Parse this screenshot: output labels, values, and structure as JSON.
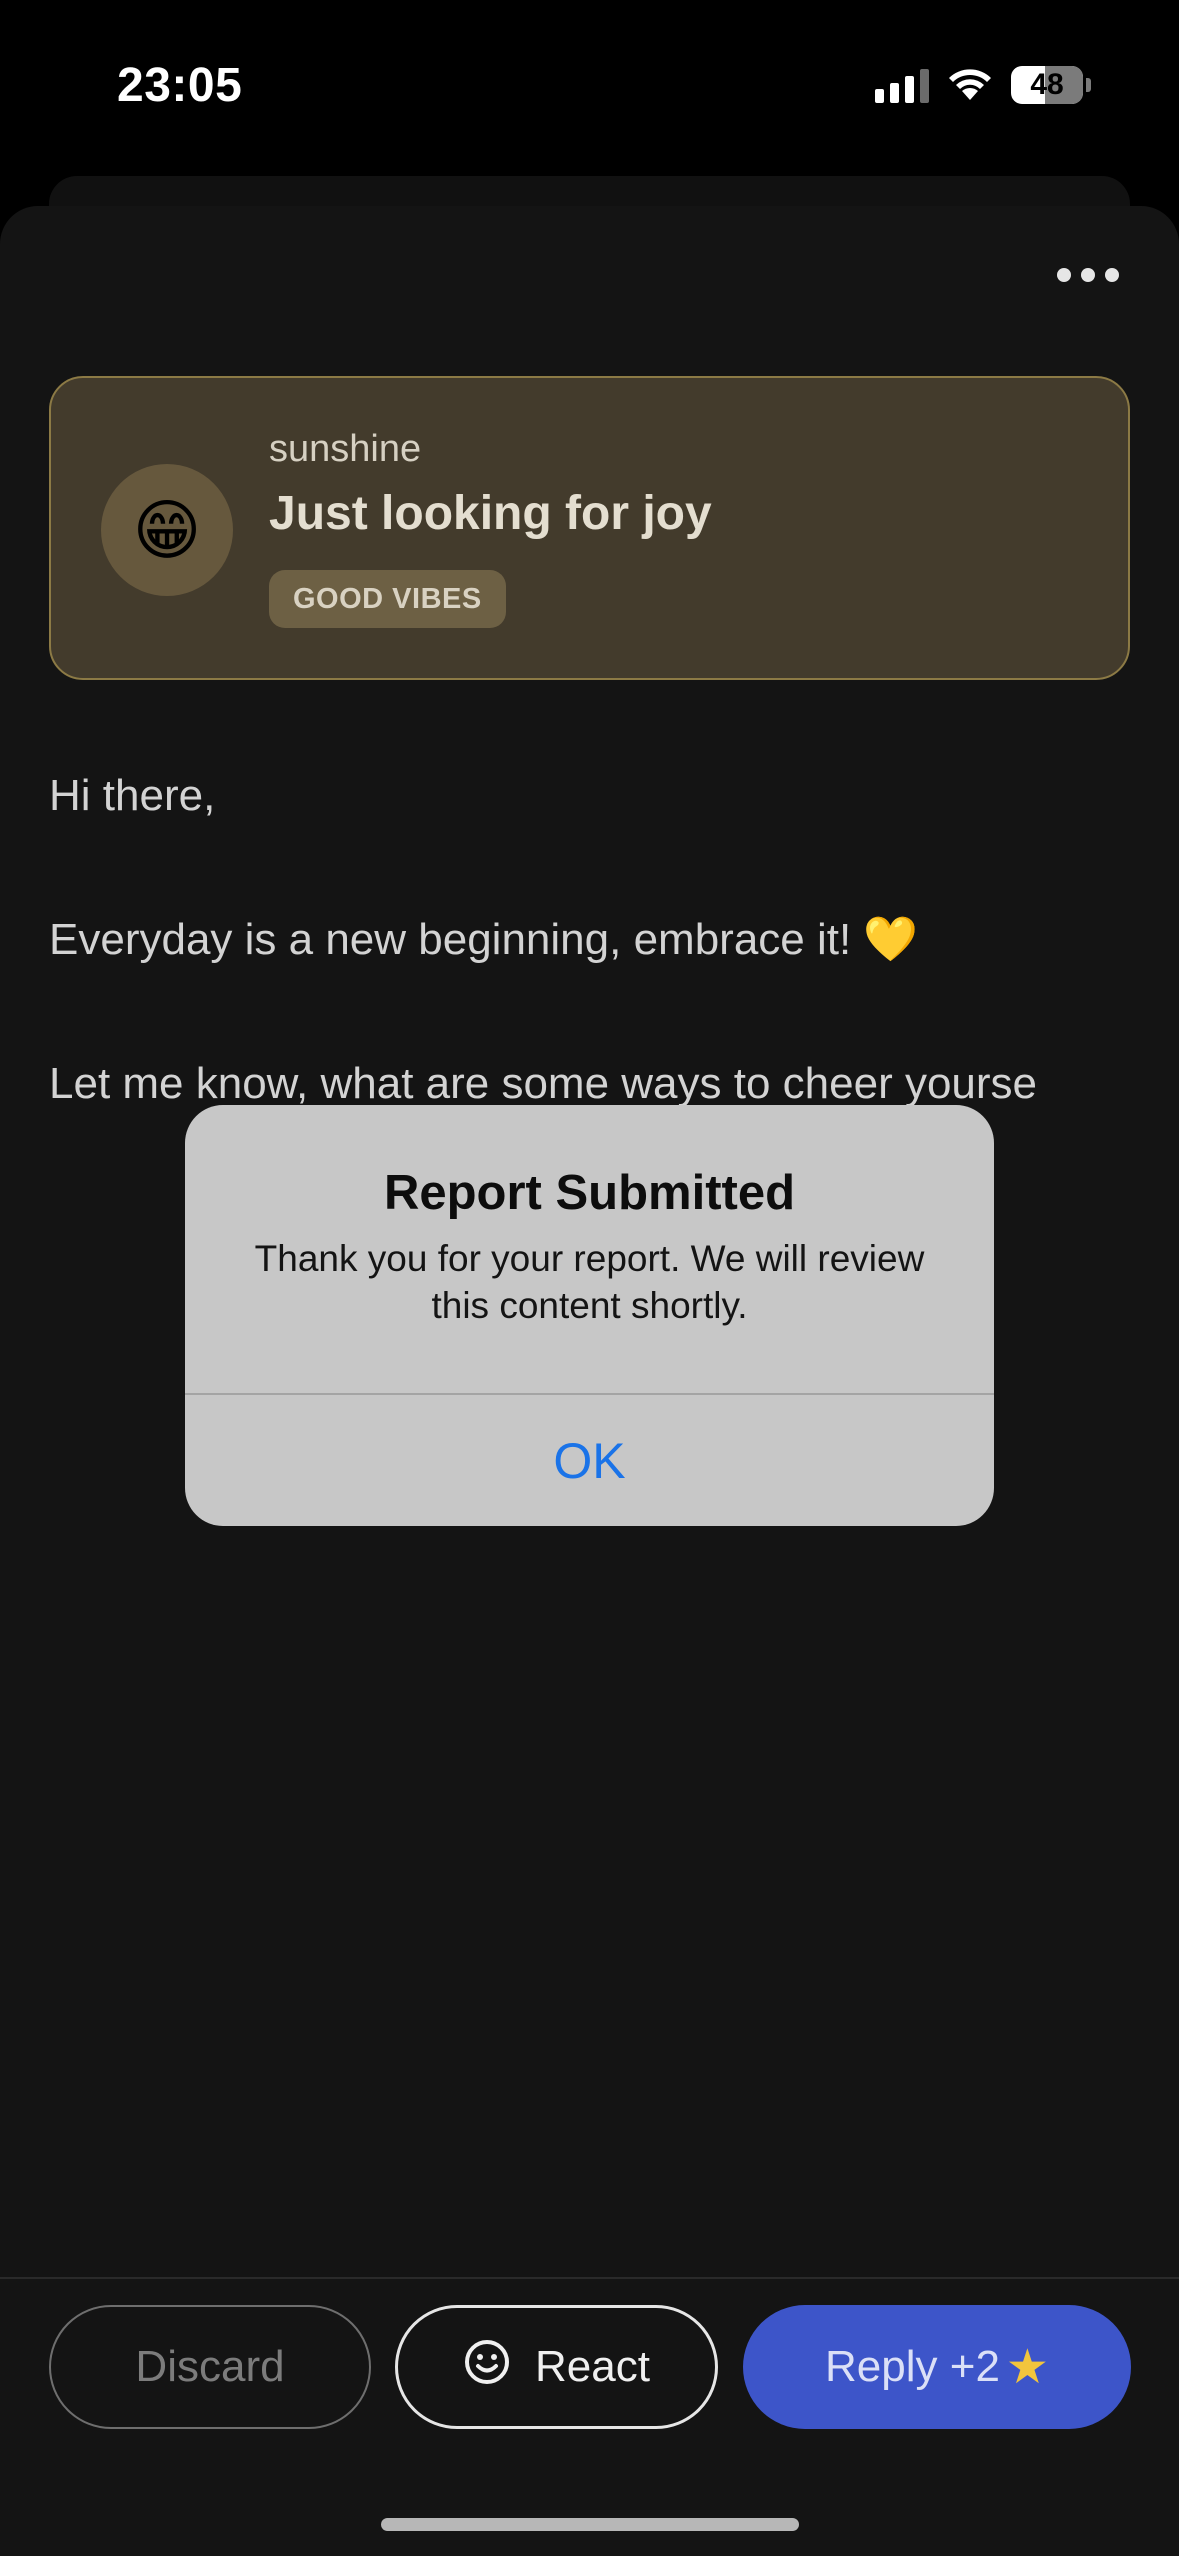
{
  "status_bar": {
    "time": "23:05",
    "battery": "48"
  },
  "profile": {
    "emoji": "😁",
    "username": "sunshine",
    "tagline": "Just looking for joy",
    "badge": "GOOD VIBES"
  },
  "post": {
    "greeting": "Hi there,",
    "line1": "Everyday is a new beginning, embrace it! 💛",
    "line2": "Let me know, what are some ways to cheer yourse"
  },
  "alert": {
    "title": "Report Submitted",
    "message": "Thank you for your report. We will review this content shortly.",
    "ok_label": "OK"
  },
  "actions": {
    "discard_label": "Discard",
    "react_label": "React",
    "reply_label": "Reply +2",
    "reply_star": "★"
  },
  "colors": {
    "accent_blue": "#3d55c9",
    "alert_link": "#1a73e8",
    "card_border": "#8c7a45",
    "star": "#f2c53d"
  }
}
